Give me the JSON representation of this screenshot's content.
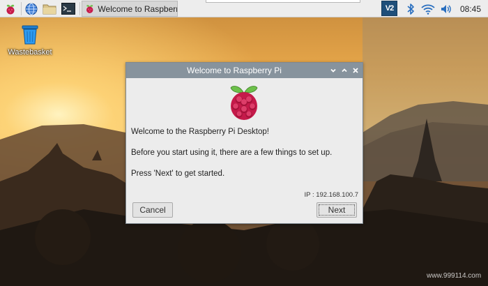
{
  "taskbar": {
    "task_title": "Welcome to Raspberr...",
    "vnc_label": "V2",
    "clock": "08:45"
  },
  "desktop": {
    "wastebasket_label": "Wastebasket"
  },
  "dialog": {
    "title": "Welcome to Raspberry Pi",
    "line1": "Welcome to the Raspberry Pi Desktop!",
    "line2": "Before you start using it, there are a few things to set up.",
    "line3": "Press 'Next' to get started.",
    "ip": "IP : 192.168.100.7",
    "cancel_label": "Cancel",
    "next_label": "Next"
  },
  "watermark": "www.999114.com",
  "icons": {
    "menu": "raspberry-icon",
    "browser": "globe-icon",
    "files": "folder-icon",
    "terminal": "terminal-icon",
    "bluetooth": "bluetooth-icon",
    "wifi": "wifi-icon",
    "volume": "volume-icon"
  },
  "colors": {
    "titlebar": "#87939d",
    "raspberry": "#c51a4a",
    "leaf": "#6cc04a"
  }
}
